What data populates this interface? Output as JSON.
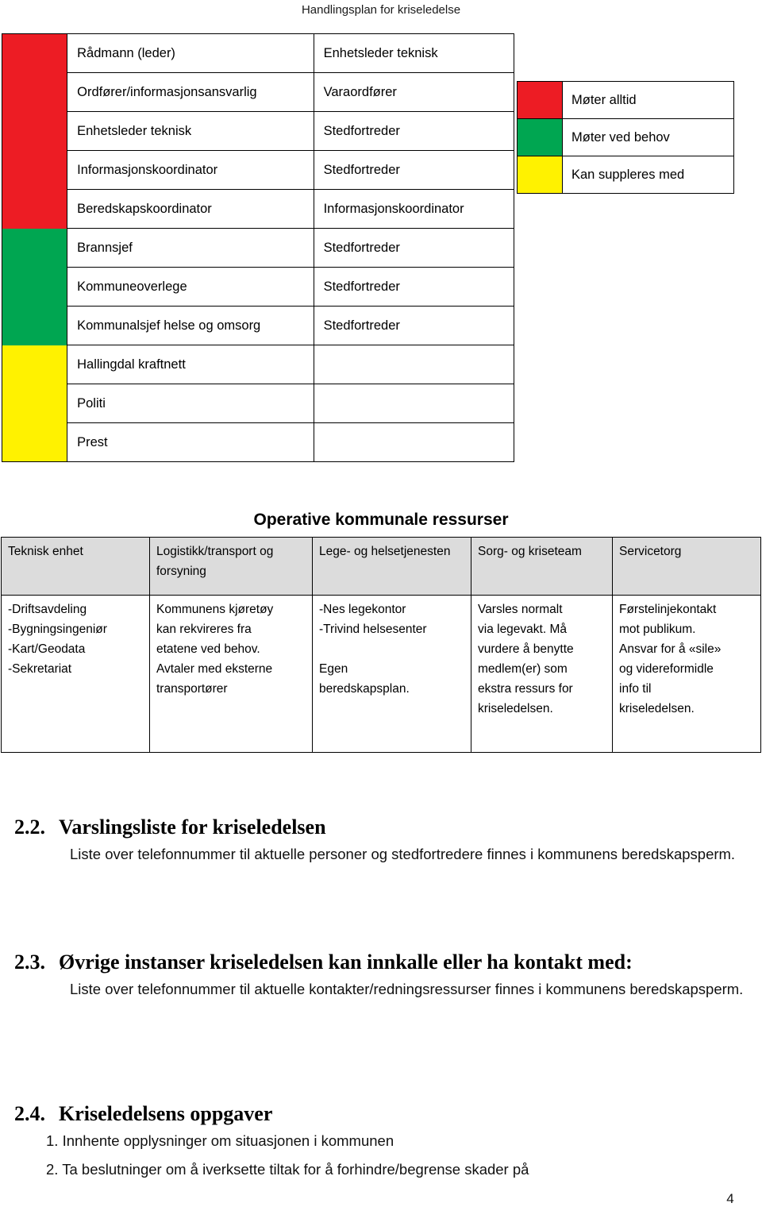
{
  "document": {
    "running_header": "Handlingsplan for kriseledelse",
    "page_number": "4"
  },
  "colors": {
    "red": "#ED1C24",
    "green": "#00A651",
    "yellow": "#FFF200",
    "header_fill": "#DCDCDC",
    "border": "#000000"
  },
  "kriseledelse_table": {
    "rows": [
      {
        "role": "Rådmann (leder)",
        "deputy": "Enhetsleder teknisk",
        "group": "red"
      },
      {
        "role": "Ordfører/informasjonsansvarlig",
        "deputy": "Varaordfører",
        "group": "red"
      },
      {
        "role": "Enhetsleder teknisk",
        "deputy": "Stedfortreder",
        "group": "red"
      },
      {
        "role": "Informasjonskoordinator",
        "deputy": "Stedfortreder",
        "group": "red"
      },
      {
        "role": "Beredskapskoordinator",
        "deputy": "Informasjonskoordinator",
        "group": "red"
      },
      {
        "role": "Brannsjef",
        "deputy": "Stedfortreder",
        "group": "green"
      },
      {
        "role": "Kommuneoverlege",
        "deputy": "Stedfortreder",
        "group": "green"
      },
      {
        "role": "Kommunalsjef helse og omsorg",
        "deputy": "Stedfortreder",
        "group": "green"
      },
      {
        "role": "Hallingdal kraftnett",
        "deputy": "",
        "group": "yellow"
      },
      {
        "role": "Politi",
        "deputy": "",
        "group": "yellow"
      },
      {
        "role": "Prest",
        "deputy": "",
        "group": "yellow"
      }
    ]
  },
  "legend": {
    "items": [
      {
        "color": "red",
        "label": "Møter alltid"
      },
      {
        "color": "green",
        "label": "Møter ved behov"
      },
      {
        "color": "yellow",
        "label": "Kan suppleres med"
      }
    ]
  },
  "ressurser_table": {
    "title": "Operative kommunale ressurser",
    "headers": [
      "Teknisk enhet",
      "Logistikk/transport og forsyning",
      "Lege- og helsetjenesten",
      "Sorg- og kriseteam",
      "Servicetorg"
    ],
    "cells": [
      {
        "lines": [
          "-Driftsavdeling",
          "-Bygningsingeniør",
          "-Kart/Geodata",
          "-Sekretariat"
        ],
        "gap_after": -1
      },
      {
        "lines": [
          "Kommunens kjøretøy",
          "kan rekvireres fra",
          "etatene ved behov.",
          "Avtaler med eksterne",
          "transportører"
        ],
        "gap_after": -1
      },
      {
        "lines": [
          "-Nes legekontor",
          "-Trivind  helsesenter",
          "Egen",
          "beredskapsplan."
        ],
        "gap_after": 1
      },
      {
        "lines": [
          "Varsles normalt",
          "via legevakt. Må",
          "vurdere å benytte",
          "medlem(er) som",
          "ekstra ressurs for",
          "kriseledelsen."
        ],
        "gap_after": -1
      },
      {
        "lines": [
          "Førstelinjekontakt",
          "mot publikum.",
          "Ansvar for å «sile»",
          "og videreformidle",
          "info til",
          "kriseledelsen."
        ],
        "gap_after": -1
      }
    ]
  },
  "sections": [
    {
      "number": "2.2.",
      "title": "Varslingsliste for kriseledelsen",
      "body": "Liste over telefonnummer til aktuelle personer og stedfortredere finnes i kommunens beredskapsperm."
    },
    {
      "number": "2.3.",
      "title": "Øvrige instanser kriseledelsen kan innkalle eller ha kontakt med:",
      "body": "Liste over telefonnummer til aktuelle kontakter/redningsressurser finnes i kommunens beredskapsperm."
    },
    {
      "number": "2.4.",
      "title": "Kriseledelsens oppgaver",
      "list": [
        "1. Innhente opplysninger om situasjonen i kommunen",
        "2. Ta beslutninger om å iverksette tiltak for å forhindre/begrense skader på"
      ]
    }
  ]
}
